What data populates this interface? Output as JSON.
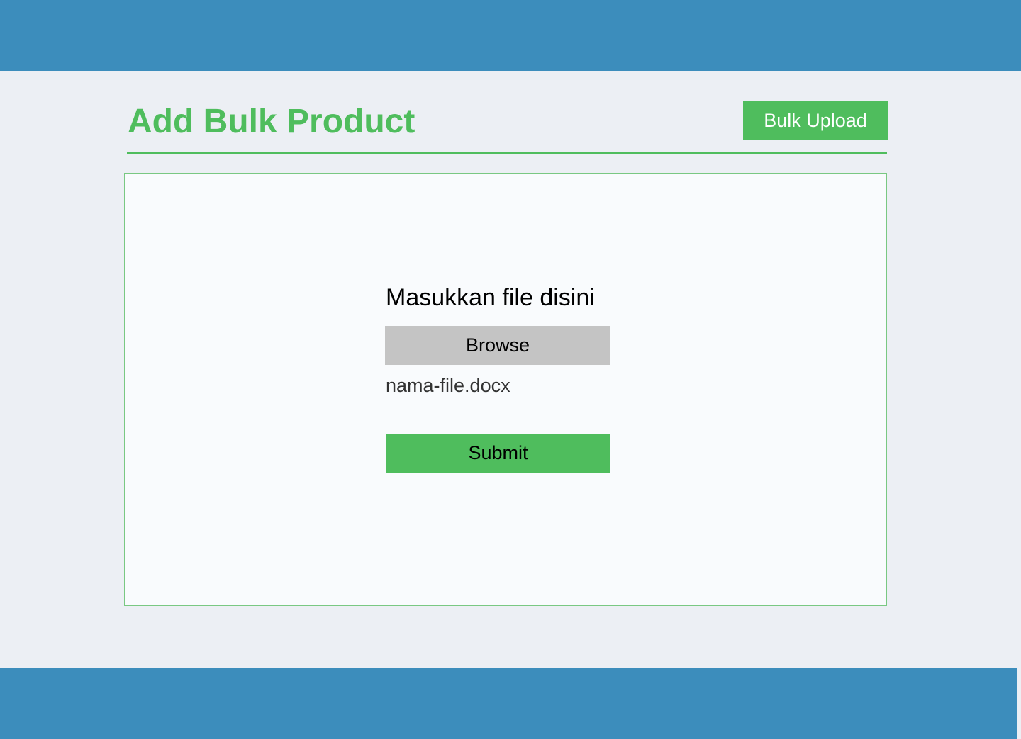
{
  "header": {
    "title": "Add Bulk Product",
    "bulk_upload_label": "Bulk Upload"
  },
  "upload": {
    "prompt": "Masukkan file disini",
    "browse_label": "Browse",
    "file_name": "nama-file.docx",
    "submit_label": "Submit"
  },
  "colors": {
    "nav_bar": "#3C8DBC",
    "accent_green": "#4FBD5D",
    "page_background": "#ECEFF4",
    "panel_background": "#F9FBFD",
    "browse_button": "#C4C4C4"
  }
}
